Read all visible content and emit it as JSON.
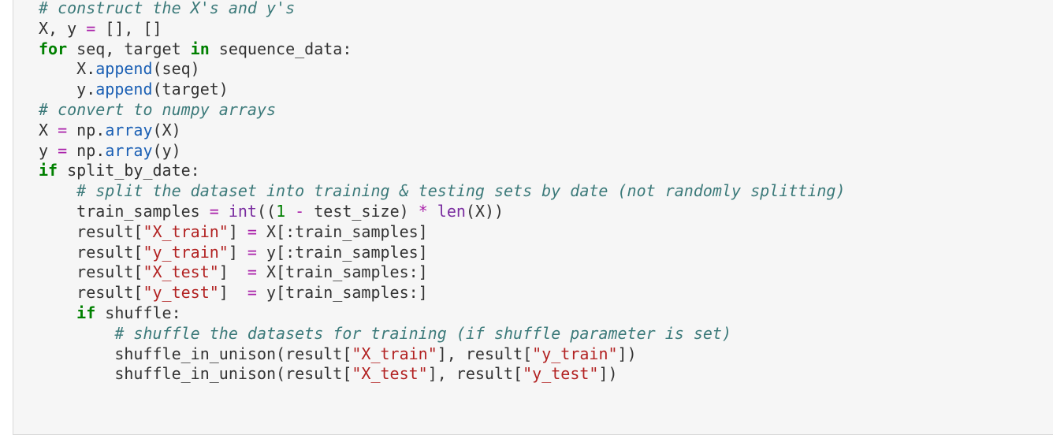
{
  "colors": {
    "background": "#f6f6f6",
    "text": "#333333",
    "comment": "#3c7a7a",
    "keyword": "#008000",
    "method": "#1a5fb4",
    "builtin": "#7a2ea0",
    "operator": "#aa22aa",
    "string": "#b22222",
    "number": "#008000"
  },
  "code_lines": [
    [
      {
        "t": "# construct the X's and y's",
        "c": "cm"
      }
    ],
    [
      {
        "t": "X, y ",
        "c": "tx"
      },
      {
        "t": "=",
        "c": "op"
      },
      {
        "t": " [], []",
        "c": "tx"
      }
    ],
    [
      {
        "t": "for",
        "c": "kw"
      },
      {
        "t": " seq, target ",
        "c": "tx"
      },
      {
        "t": "in",
        "c": "kw"
      },
      {
        "t": " sequence_data:",
        "c": "tx"
      }
    ],
    [
      {
        "t": "    X.",
        "c": "tx"
      },
      {
        "t": "append",
        "c": "fn"
      },
      {
        "t": "(seq)",
        "c": "tx"
      }
    ],
    [
      {
        "t": "    y.",
        "c": "tx"
      },
      {
        "t": "append",
        "c": "fn"
      },
      {
        "t": "(target)",
        "c": "tx"
      }
    ],
    [
      {
        "t": "# convert to numpy arrays",
        "c": "cm"
      }
    ],
    [
      {
        "t": "X ",
        "c": "tx"
      },
      {
        "t": "=",
        "c": "op"
      },
      {
        "t": " np.",
        "c": "tx"
      },
      {
        "t": "array",
        "c": "fn"
      },
      {
        "t": "(X)",
        "c": "tx"
      }
    ],
    [
      {
        "t": "y ",
        "c": "tx"
      },
      {
        "t": "=",
        "c": "op"
      },
      {
        "t": " np.",
        "c": "tx"
      },
      {
        "t": "array",
        "c": "fn"
      },
      {
        "t": "(y)",
        "c": "tx"
      }
    ],
    [
      {
        "t": "if",
        "c": "kw"
      },
      {
        "t": " split_by_date:",
        "c": "tx"
      }
    ],
    [
      {
        "t": "    ",
        "c": "tx"
      },
      {
        "t": "# split the dataset into training & testing sets by date (not randomly splitting)",
        "c": "cm"
      }
    ],
    [
      {
        "t": "    train_samples ",
        "c": "tx"
      },
      {
        "t": "=",
        "c": "op"
      },
      {
        "t": " ",
        "c": "tx"
      },
      {
        "t": "int",
        "c": "bi"
      },
      {
        "t": "((",
        "c": "tx"
      },
      {
        "t": "1",
        "c": "num"
      },
      {
        "t": " ",
        "c": "tx"
      },
      {
        "t": "-",
        "c": "op"
      },
      {
        "t": " test_size) ",
        "c": "tx"
      },
      {
        "t": "*",
        "c": "op"
      },
      {
        "t": " ",
        "c": "tx"
      },
      {
        "t": "len",
        "c": "bi"
      },
      {
        "t": "(X))",
        "c": "tx"
      }
    ],
    [
      {
        "t": "    result[",
        "c": "tx"
      },
      {
        "t": "\"X_train\"",
        "c": "str"
      },
      {
        "t": "] ",
        "c": "tx"
      },
      {
        "t": "=",
        "c": "op"
      },
      {
        "t": " X[:train_samples]",
        "c": "tx"
      }
    ],
    [
      {
        "t": "    result[",
        "c": "tx"
      },
      {
        "t": "\"y_train\"",
        "c": "str"
      },
      {
        "t": "] ",
        "c": "tx"
      },
      {
        "t": "=",
        "c": "op"
      },
      {
        "t": " y[:train_samples]",
        "c": "tx"
      }
    ],
    [
      {
        "t": "    result[",
        "c": "tx"
      },
      {
        "t": "\"X_test\"",
        "c": "str"
      },
      {
        "t": "]  ",
        "c": "tx"
      },
      {
        "t": "=",
        "c": "op"
      },
      {
        "t": " X[train_samples:]",
        "c": "tx"
      }
    ],
    [
      {
        "t": "    result[",
        "c": "tx"
      },
      {
        "t": "\"y_test\"",
        "c": "str"
      },
      {
        "t": "]  ",
        "c": "tx"
      },
      {
        "t": "=",
        "c": "op"
      },
      {
        "t": " y[train_samples:]",
        "c": "tx"
      }
    ],
    [
      {
        "t": "    ",
        "c": "tx"
      },
      {
        "t": "if",
        "c": "kw"
      },
      {
        "t": " shuffle:",
        "c": "tx"
      }
    ],
    [
      {
        "t": "        ",
        "c": "tx"
      },
      {
        "t": "# shuffle the datasets for training (if shuffle parameter is set)",
        "c": "cm"
      }
    ],
    [
      {
        "t": "        shuffle_in_unison(result[",
        "c": "tx"
      },
      {
        "t": "\"X_train\"",
        "c": "str"
      },
      {
        "t": "], result[",
        "c": "tx"
      },
      {
        "t": "\"y_train\"",
        "c": "str"
      },
      {
        "t": "])",
        "c": "tx"
      }
    ],
    [
      {
        "t": "        shuffle_in_unison(result[",
        "c": "tx"
      },
      {
        "t": "\"X_test\"",
        "c": "str"
      },
      {
        "t": "], result[",
        "c": "tx"
      },
      {
        "t": "\"y_test\"",
        "c": "str"
      },
      {
        "t": "])",
        "c": "tx"
      }
    ]
  ]
}
